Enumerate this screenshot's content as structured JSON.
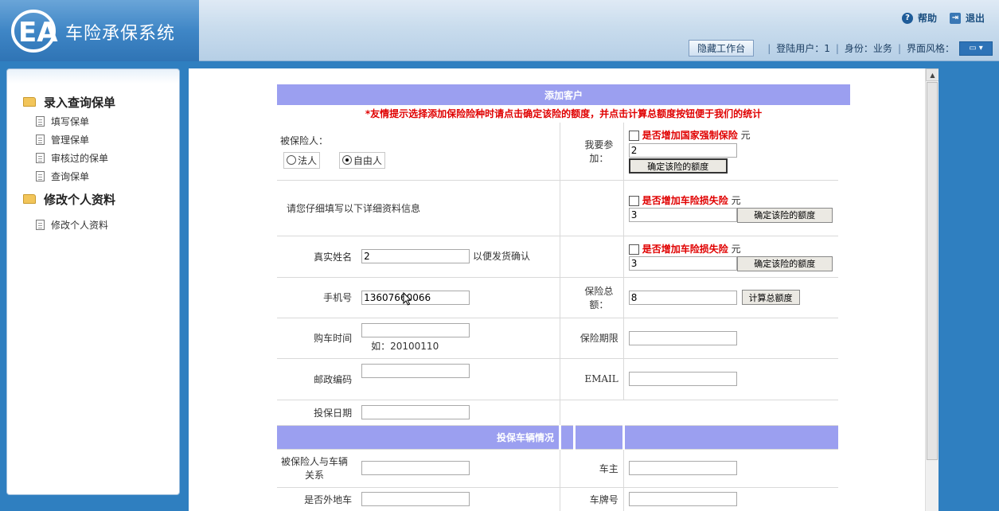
{
  "app": {
    "title": "车险承保系统",
    "help": "帮助",
    "logout": "退出"
  },
  "userbar": {
    "hide_workbench": "隐藏工作台",
    "user_label": "登陆用户：1",
    "role_label": "身份：业务",
    "style_label": "界面风格："
  },
  "sidebar": {
    "groups": [
      {
        "title": "录入查询保单",
        "items": [
          "填写保单",
          "管理保单",
          "审核过的保单",
          "查询保单"
        ]
      },
      {
        "title": "修改个人资料",
        "items": [
          "修改个人资料"
        ]
      }
    ]
  },
  "form": {
    "title": "添加客户",
    "tip": "*友情提示选择添加保险险种时请点击确定该险的额度，并点击计算总额度按钮便于我们的统计",
    "insured_label": "被保险人：",
    "radio_legal": "法人",
    "radio_individual": "自由人",
    "selected_radio": "自由人",
    "join_label": "我要参加：",
    "compulsory_label": "是否增加国家强制保险",
    "unit": "元",
    "compulsory_value": "2",
    "confirm_label": "确定该险的额度",
    "fill_hint": "请您仔细填写以下详细资料信息",
    "damage_label": "是否增加车险损失险",
    "damage_value": "3",
    "damage2_label": "是否增加车险损失险",
    "damage2_value": "3",
    "name_label": "真实姓名",
    "name_value": "2",
    "name_hint": "以便发货确认",
    "phone_label": "手机号",
    "phone_value": "13607660066",
    "total_label": "保险总额：",
    "total_value": "8",
    "calc_label": "计算总额度",
    "buy_time_label": "购车时间",
    "buy_time_example": "如：20100110",
    "period_label": "保险期限",
    "postcode_label": "邮政编码",
    "email_label": "EMAIL",
    "insure_date_label": "投保日期",
    "vehicle_section": "投保车辆情况",
    "relation_label": "被保险人与车辆关系",
    "owner_label": "车主",
    "nonlocal_label": "是否外地车",
    "plate_label": "车牌号"
  }
}
